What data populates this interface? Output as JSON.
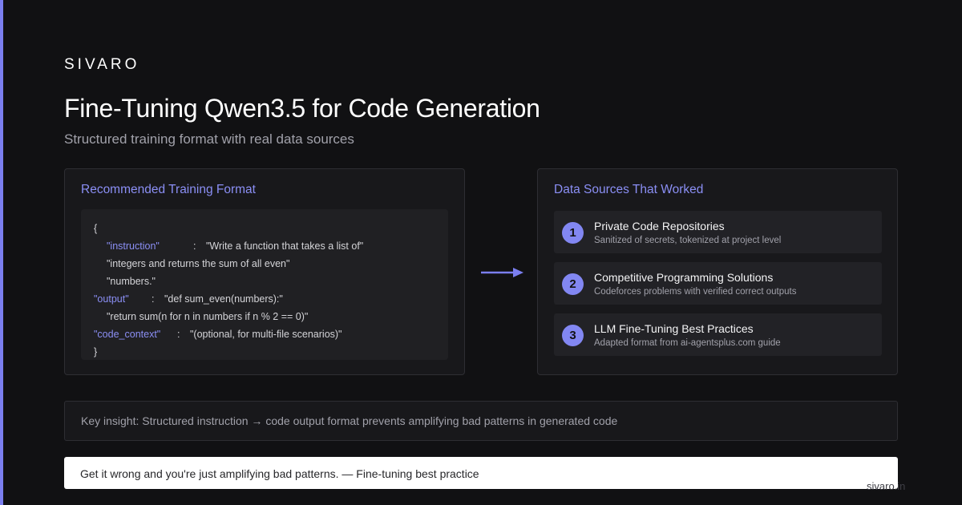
{
  "brand": "SIVARO",
  "title": "Fine-Tuning Qwen3.5 for Code Generation",
  "subtitle": "Structured training format with real data sources",
  "training_format": {
    "heading": "Recommended Training Format",
    "code": {
      "open_brace": "{",
      "instruction_key": "\"instruction\"",
      "instruction_colon": ":",
      "instruction_line1": "\"Write a function that takes a list of\"",
      "instruction_line2": "\"integers and returns the sum of all even\"",
      "instruction_line3": "\"numbers.\"",
      "output_key": "\"output\"",
      "output_colon": ":",
      "output_line1": "\"def sum_even(numbers):\"",
      "output_line2": "\"return sum(n for n in numbers if n % 2 == 0)\"",
      "context_key": "\"code_context\"",
      "context_colon": ":",
      "context_value": "\"(optional, for multi-file scenarios)\"",
      "close_brace": "}"
    }
  },
  "data_sources": {
    "heading": "Data Sources That Worked",
    "items": [
      {
        "number": "1",
        "title": "Private Code Repositories",
        "description": "Sanitized of secrets, tokenized at project level"
      },
      {
        "number": "2",
        "title": "Competitive Programming Solutions",
        "description": "Codeforces problems with verified correct outputs"
      },
      {
        "number": "3",
        "title": "LLM Fine-Tuning Best Practices",
        "description": "Adapted format from ai-agentsplus.com guide"
      }
    ]
  },
  "insight": "Key insight: Structured instruction → code output format prevents amplifying bad patterns in generated code",
  "quote": "Get it wrong and you're just amplifying bad patterns. — Fine-tuning best practice",
  "watermark": "sivaro.in",
  "colors": {
    "background": "#111113",
    "accent": "#7b7ff0",
    "card": "#18181b",
    "badge": "#8287f2"
  }
}
